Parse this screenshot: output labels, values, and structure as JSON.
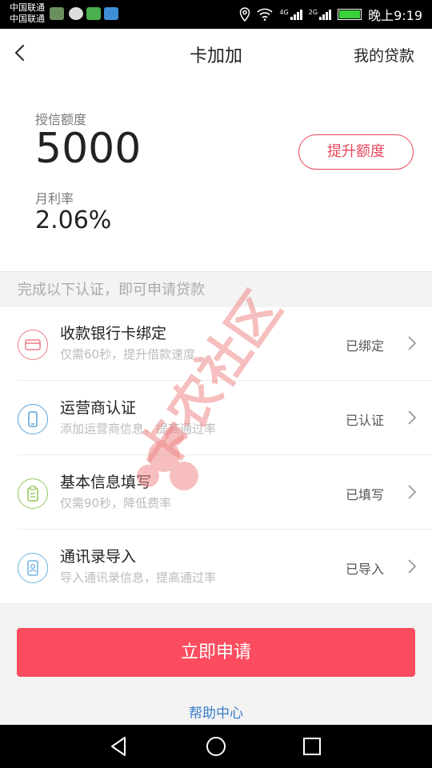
{
  "status_bar": {
    "carrier_1": "中国联通",
    "carrier_2": "中国联通",
    "net_1": "4G",
    "net_2": "2G",
    "time": "晚上9:19"
  },
  "nav": {
    "title": "卡加加",
    "right_link": "我的贷款"
  },
  "credit": {
    "limit_label": "授信额度",
    "limit_value": "5000",
    "raise_button": "提升额度",
    "rate_label": "月利率",
    "rate_value": "2.06%"
  },
  "hint": "完成以下认证，即可申请贷款",
  "items": [
    {
      "title": "收款银行卡绑定",
      "subtitle": "仅需60秒，提升借款速度",
      "status": "已绑定",
      "icon": "card-icon",
      "color": "#ec7d86"
    },
    {
      "title": "运营商认证",
      "subtitle": "添加运营商信息，提高通过率",
      "status": "已认证",
      "icon": "phone-icon",
      "color": "#5ba4d8"
    },
    {
      "title": "基本信息填写",
      "subtitle": "仅需90秒，降低费率",
      "status": "已填写",
      "icon": "clipboard-icon",
      "color": "#93c65b"
    },
    {
      "title": "通讯录导入",
      "subtitle": "导入通讯录信息，提高通过率",
      "status": "已导入",
      "icon": "contacts-icon",
      "color": "#6fb3dd"
    }
  ],
  "apply_button": "立即申请",
  "help_link": "帮助中心",
  "watermark": "卡农社区",
  "colors": {
    "accent": "#fb4d5f",
    "link": "#3a7cc7"
  }
}
